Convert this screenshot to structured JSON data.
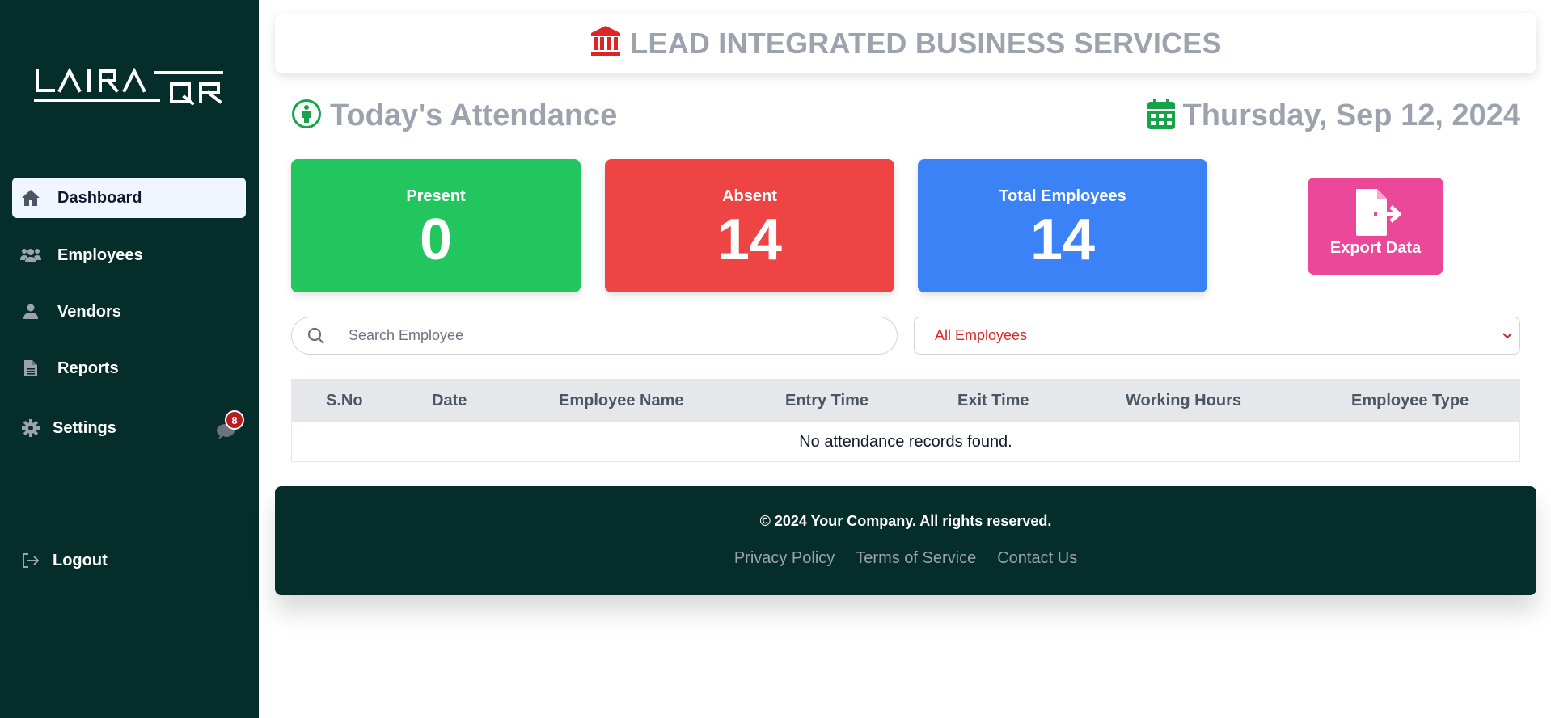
{
  "sidebar": {
    "logo": "LAIRAQR",
    "items": [
      {
        "label": "Dashboard",
        "icon": "home-icon"
      },
      {
        "label": "Employees",
        "icon": "users-icon"
      },
      {
        "label": "Vendors",
        "icon": "user-icon"
      },
      {
        "label": "Reports",
        "icon": "file-icon"
      },
      {
        "label": "Settings",
        "icon": "gear-icon"
      }
    ],
    "notification_count": "8",
    "logout_label": "Logout"
  },
  "header": {
    "title": "LEAD INTEGRATED BUSINESS SERVICES"
  },
  "attendance": {
    "title": "Today's Attendance",
    "date": "Thursday, Sep 12, 2024"
  },
  "stats": {
    "present_label": "Present",
    "present_value": "0",
    "absent_label": "Absent",
    "absent_value": "14",
    "total_label": "Total Employees",
    "total_value": "14"
  },
  "export": {
    "label": "Export Data"
  },
  "search": {
    "placeholder": "Search Employee"
  },
  "filter": {
    "selected": "All Employees"
  },
  "table": {
    "columns": [
      "S.No",
      "Date",
      "Employee Name",
      "Entry Time",
      "Exit Time",
      "Working Hours",
      "Employee Type"
    ],
    "empty_message": "No attendance records found."
  },
  "footer": {
    "copyright": "© 2024 Your Company. All rights reserved.",
    "links": [
      "Privacy Policy",
      "Terms of Service",
      "Contact Us"
    ]
  },
  "colors": {
    "sidebar_bg": "#052e2b",
    "present": "#22c55e",
    "absent": "#ef4444",
    "total": "#3b82f6",
    "export": "#ec4899",
    "header_text": "#9ca3af"
  }
}
